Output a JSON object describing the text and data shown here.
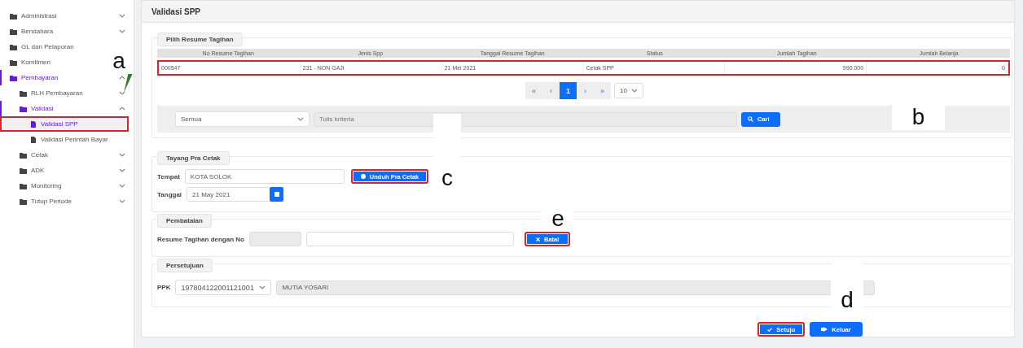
{
  "sidebar": {
    "items": [
      {
        "label": "Administrasi",
        "kind": "folder",
        "expanded": false,
        "selected": false
      },
      {
        "label": "Bendahara",
        "kind": "folder",
        "expanded": false,
        "selected": false
      },
      {
        "label": "GL dan Pelaporan",
        "kind": "folder",
        "selected": false
      },
      {
        "label": "Komitmen",
        "kind": "folder",
        "selected": false
      },
      {
        "label": "Pembayaran",
        "kind": "folder",
        "expanded": true,
        "selected": false,
        "children": [
          {
            "label": "RLH Pembayaran",
            "kind": "folder",
            "expanded": false,
            "selected": false
          },
          {
            "label": "Validasi",
            "kind": "folder",
            "expanded": true,
            "selected": false,
            "children": [
              {
                "label": "Validasi SPP",
                "kind": "page",
                "selected": true,
                "highlighted": true
              },
              {
                "label": "Validasi Perintah Bayar",
                "kind": "page",
                "selected": false,
                "highlighted": false
              }
            ]
          },
          {
            "label": "Cetak",
            "kind": "folder",
            "expanded": false,
            "selected": false
          },
          {
            "label": "ADK",
            "kind": "folder",
            "expanded": false,
            "selected": false
          },
          {
            "label": "Monitoring",
            "kind": "folder",
            "expanded": false,
            "selected": false
          },
          {
            "label": "Tutup Periode",
            "kind": "folder",
            "expanded": false,
            "selected": false
          }
        ]
      }
    ]
  },
  "page": {
    "title": "Validasi SPP"
  },
  "resume_panel": {
    "legend": "Pilih Resume Tagihan",
    "table": {
      "columns": [
        "No Resume Tagihan",
        "Jenis Spp",
        "Tanggal Resume Tagihan",
        "Status",
        "Jumlah Tagihan",
        "Jumlah Belanja"
      ],
      "rows": [
        {
          "cells": [
            "000547",
            "231 - NON GAJI",
            "21 Mei 2021",
            "Cetak SPP",
            "990.000",
            "0"
          ],
          "highlighted": true
        }
      ]
    },
    "pagination": {
      "pages": [
        {
          "label": "«",
          "selected": false
        },
        {
          "label": "‹",
          "selected": false
        },
        {
          "label": "1",
          "selected": true
        },
        {
          "label": "›",
          "selected": false
        },
        {
          "label": "»",
          "selected": false
        }
      ],
      "page_size": "10"
    },
    "search": {
      "filter": "Semua",
      "placeholder": "Tulis kriteria",
      "button": "Cari"
    }
  },
  "pra_cetak": {
    "legend": "Tayang Pra Cetak",
    "tempat_label": "Tempat",
    "tempat_value": "KOTA SOLOK",
    "download_button": {
      "label": "Unduh Pra Cetak",
      "highlighted": true
    },
    "tanggal_label": "Tanggal",
    "tanggal_value": "21 May 2021"
  },
  "pembatalan": {
    "legend": "Pembatalan",
    "label": "Resume Tagihan dengan No",
    "button": {
      "label": "Batal",
      "highlighted": true
    }
  },
  "persetujuan": {
    "legend": "Persetujuan",
    "label": "PPK",
    "ppk_value": "197804122001121001",
    "name_value": "MUTIA YOSARI"
  },
  "actions": [
    {
      "label": "Setuju",
      "kind": "approve",
      "highlighted": true
    },
    {
      "label": "Keluar",
      "kind": "exit",
      "highlighted": false
    }
  ],
  "callouts": [
    "a",
    "b",
    "c",
    "e",
    "d"
  ]
}
